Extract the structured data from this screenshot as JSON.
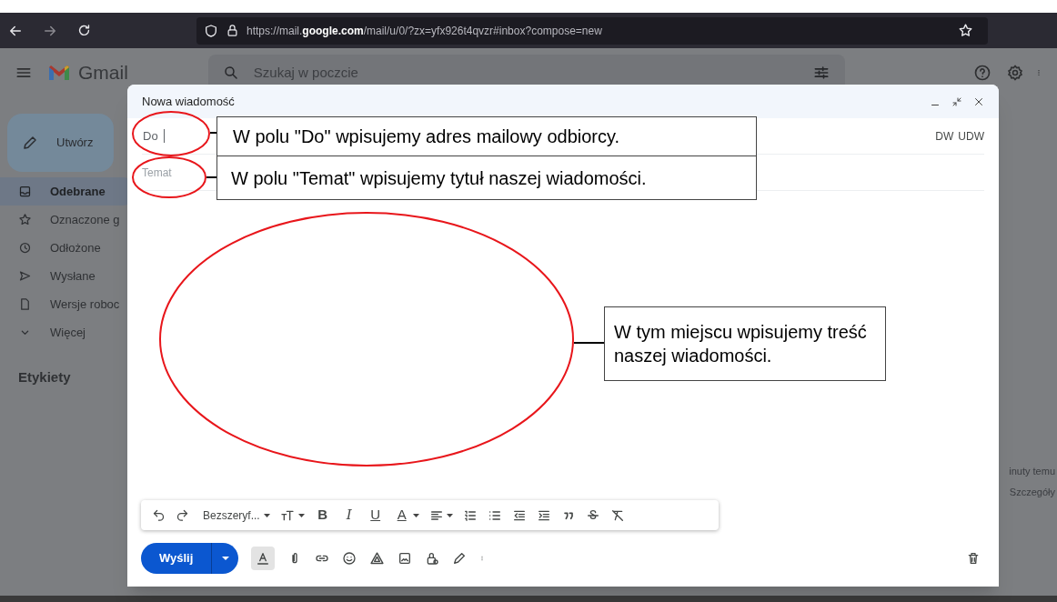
{
  "browser": {
    "url": "https://mail.**google.com**/mail/u/0/?zx=yfx926t4qvzr#inbox?compose=new"
  },
  "gmail": {
    "app_name": "Gmail",
    "search_placeholder": "Szukaj w poczcie",
    "compose_button": "Utwórz",
    "sidebar": [
      {
        "kind": "inbox",
        "label": "Odebrane",
        "selected": true
      },
      {
        "kind": "star",
        "label": "Oznaczone g",
        "selected": false
      },
      {
        "kind": "clock",
        "label": "Odłożone",
        "selected": false
      },
      {
        "kind": "send",
        "label": "Wysłane",
        "selected": false
      },
      {
        "kind": "draft",
        "label": "Wersje roboc",
        "selected": false
      },
      {
        "kind": "more",
        "label": "Więcej",
        "selected": false
      }
    ],
    "labels_heading": "Etykiety",
    "background_lines": [
      "inuty temu",
      "Szczegóły"
    ]
  },
  "compose": {
    "title": "Nowa wiadomość",
    "to_label": "Do",
    "cc_links": [
      "DW",
      "UDW"
    ],
    "subject_placeholder": "Temat",
    "font": "Bezszeryf...",
    "format_letters": [
      "B",
      "I",
      "U",
      "A"
    ],
    "send_button": "Wyślij"
  },
  "annotations": [
    {
      "text": "W polu \"Do\" wpisujemy adres mailowy odbiorcy."
    },
    {
      "text": "W polu \"Temat\" wpisujemy tytuł naszej wiadomości."
    },
    {
      "text": "W tym miejscu wpisujemy treść naszej wiadomości."
    }
  ]
}
